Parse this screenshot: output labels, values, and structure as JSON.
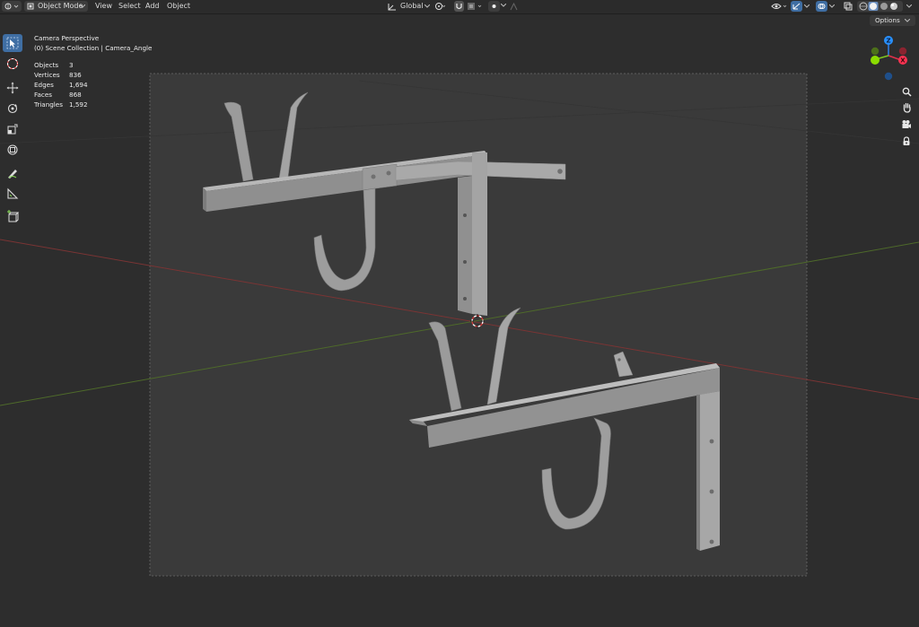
{
  "header": {
    "mode": {
      "label": "Object Mode"
    },
    "menus": [
      {
        "label": "View"
      },
      {
        "label": "Select"
      },
      {
        "label": "Add"
      },
      {
        "label": "Object"
      }
    ],
    "transform_orientation": {
      "label": "Global"
    }
  },
  "viewport": {
    "options_label": "Options",
    "overlay": {
      "view_name": "Camera Perspective",
      "collection": "(0) Scene Collection | Camera_Angle"
    },
    "stats": [
      {
        "label": "Objects",
        "value": "3"
      },
      {
        "label": "Vertices",
        "value": "836"
      },
      {
        "label": "Edges",
        "value": "1,694"
      },
      {
        "label": "Faces",
        "value": "868"
      },
      {
        "label": "Triangles",
        "value": "1,592"
      }
    ],
    "gizmo": {
      "z_label": "Z",
      "x_label": "X"
    }
  },
  "tools": [
    {
      "icon": "select-box-icon",
      "active": true
    },
    {
      "icon": "cursor-icon"
    },
    {
      "icon": "move-icon"
    },
    {
      "icon": "rotate-icon"
    },
    {
      "icon": "scale-icon"
    },
    {
      "icon": "transform-icon"
    },
    {
      "icon": "annotate-icon"
    },
    {
      "icon": "measure-icon"
    },
    {
      "icon": "add-cube-icon"
    }
  ],
  "nav_buttons": [
    {
      "icon": "zoom-icon"
    },
    {
      "icon": "hand-icon"
    },
    {
      "icon": "camera-icon"
    },
    {
      "icon": "lock-icon"
    }
  ],
  "colors": {
    "header_bg": "#2b2b2b",
    "viewport_bg": "#2d2d2d",
    "camera_frame_bg": "#3a3a3a",
    "active_tool": "#3f6ea3",
    "axis_x": "#ff3352",
    "axis_y": "#8bdc00",
    "axis_z": "#2890ff",
    "model_light": "#a6a6a6",
    "model_mid": "#8c8c8c",
    "model_dark": "#6e6e6e"
  }
}
